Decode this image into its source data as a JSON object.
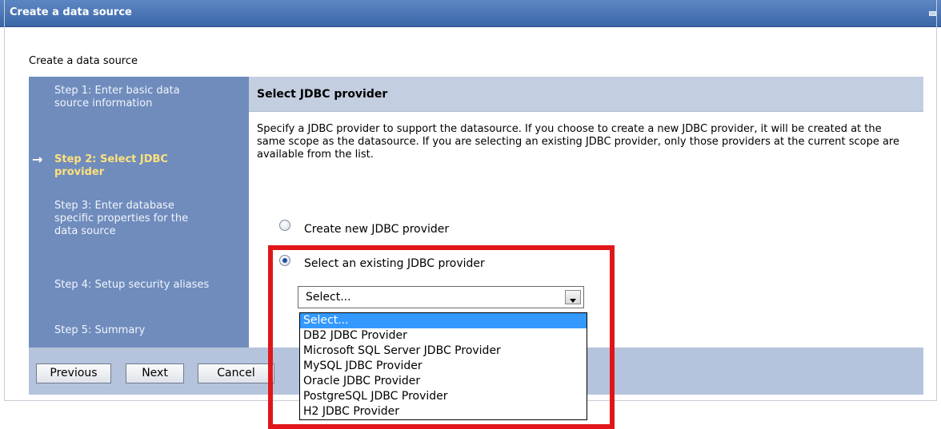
{
  "window": {
    "title": "Create a data source"
  },
  "page": {
    "heading": "Create a data source"
  },
  "steps": [
    {
      "label": "Step 1: Enter basic data source information",
      "current": false
    },
    {
      "label": "Step 2: Select JDBC provider",
      "current": true
    },
    {
      "label": "Step 3: Enter database specific properties for the data source",
      "current": false
    },
    {
      "label": "Step 4: Setup security aliases",
      "current": false
    },
    {
      "label": "Step 5: Summary",
      "current": false
    }
  ],
  "content": {
    "header": "Select JDBC provider",
    "description": "Specify a JDBC provider to support the datasource. If you choose to create a new JDBC provider, it will be created at the same scope as the datasource. If you are selecting an existing JDBC provider, only those providers at the current scope are available from the list.",
    "radio_new_label": "Create new JDBC provider",
    "radio_existing_label": "Select an existing JDBC provider",
    "selected_radio": "existing"
  },
  "provider_select": {
    "value": "Select...",
    "options": [
      "Select...",
      "DB2 JDBC Provider",
      "Microsoft SQL Server JDBC Provider",
      "MySQL JDBC Provider",
      "Oracle JDBC Provider",
      "PostgreSQL JDBC Provider",
      "H2 JDBC Provider"
    ]
  },
  "buttons": {
    "previous": "Previous",
    "next": "Next",
    "cancel": "Cancel"
  },
  "colors": {
    "titlebar": "#3b67a8",
    "sidebar": "#6f8cbd",
    "current_step": "#ffe17c",
    "highlight": "#e0161a",
    "selected_option": "#3399ff"
  }
}
